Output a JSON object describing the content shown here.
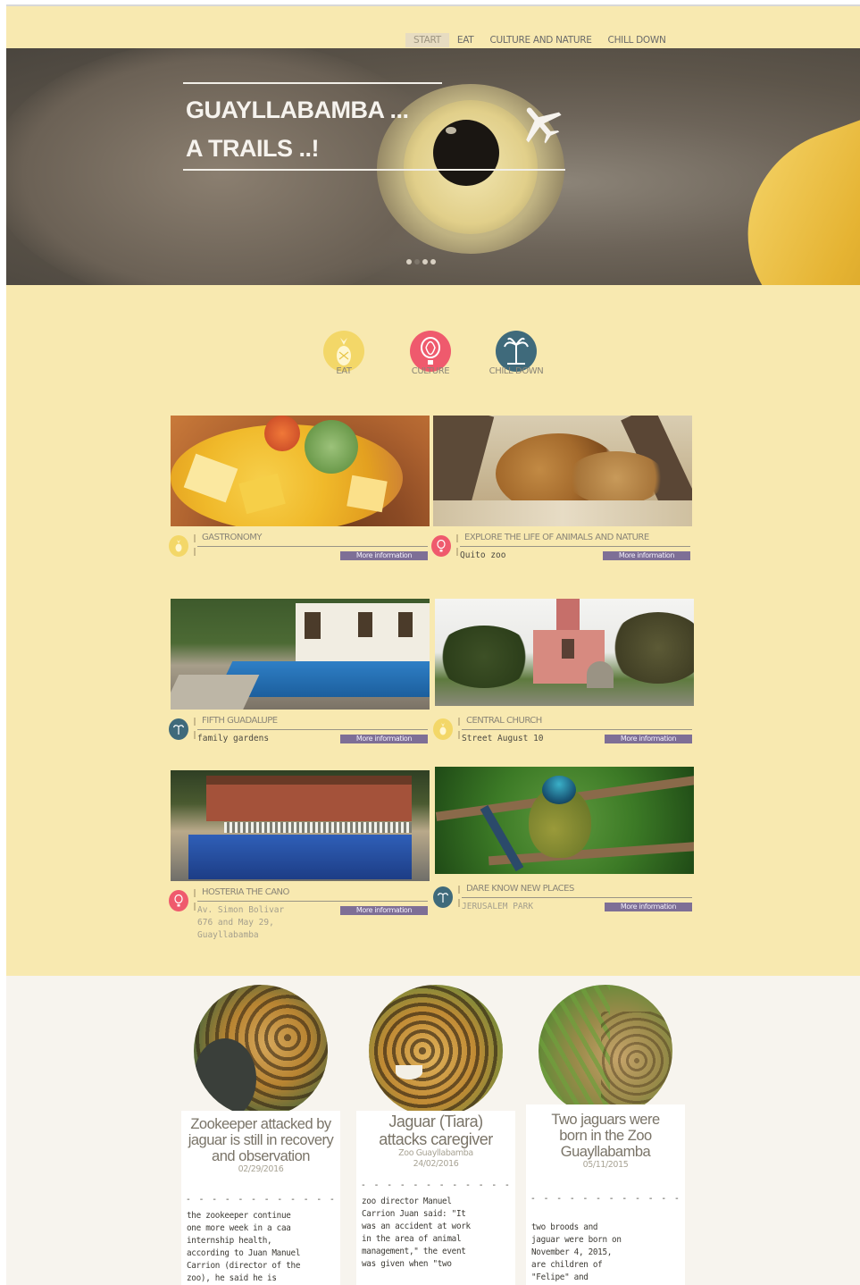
{
  "nav": {
    "items": [
      "START",
      "EAT",
      "CULTURE AND NATURE",
      "CHILL DOWN"
    ]
  },
  "hero": {
    "title_line1": "GUAYLLABAMBA ...",
    "title_line2": "A TRAILS ..!",
    "slides": {
      "count": 4,
      "active": 2
    }
  },
  "categories": [
    {
      "label": "EAT",
      "color": "#f3d768",
      "icon": "pineapple-icon"
    },
    {
      "label": "CULTURE",
      "color": "#ef5a6d",
      "icon": "hot-air-balloon-icon"
    },
    {
      "label": "CHILL DOWN",
      "color": "#3f6a7b",
      "icon": "palm-tree-icon"
    }
  ],
  "cards": [
    {
      "title": "GASTRONOMY",
      "subtitle": "",
      "more": "More information",
      "pin_color": "#f3d768",
      "pin_icon": "pineapple-icon",
      "image": "soup-photo"
    },
    {
      "title": "EXPLORE THE LIFE OF ANIMALS AND NATURE",
      "subtitle": "Quito zoo",
      "more": "More information",
      "pin_color": "#ef5a6d",
      "pin_icon": "hot-air-balloon-icon",
      "image": "lion-photo"
    },
    {
      "title": "FIFTH GUADALUPE",
      "subtitle": "family gardens",
      "more": "More information",
      "pin_color": "#3f6a7b",
      "pin_icon": "palm-tree-icon",
      "image": "pool-garden-photo"
    },
    {
      "title": "CENTRAL CHURCH",
      "subtitle": "Street August 10",
      "more": "More information",
      "pin_color": "#f3d768",
      "pin_icon": "pineapple-icon",
      "image": "church-photo"
    },
    {
      "title": "HOSTERIA THE CANO",
      "subtitle_lines": [
        "Av. Simon Bolivar",
        "676 and May 29,",
        "Guayllabamba"
      ],
      "more": "More information",
      "pin_color": "#ef5a6d",
      "pin_icon": "hot-air-balloon-icon",
      "image": "hostel-pool-photo"
    },
    {
      "title": "DARE KNOW NEW PLACES",
      "subtitle": "JERUSALEM PARK",
      "more": "More information",
      "pin_color": "#3f6a7b",
      "pin_icon": "palm-tree-icon",
      "image": "bird-photo"
    }
  ],
  "news": [
    {
      "headline": "Zookeeper attacked by jaguar is still in recovery and observation",
      "source": "",
      "date": "02/29/2016",
      "dash": "- - - - - - - - - - - -",
      "body": [
        "the zookeeper continue",
        "one more week in a caa",
        "internship health,",
        "according to Juan Manuel",
        "Carrion (director of the",
        "zoo), he said he is"
      ]
    },
    {
      "headline": "Jaguar (Tiara) attacks caregiver",
      "source": "Zoo Guayllabamba",
      "date": "24/02/2016",
      "dash": "- - - - - - - - - - - -",
      "body": [
        "zoo director Manuel",
        "Carrion Juan said: \"It",
        "was an accident at work",
        "in the area of animal",
        "management,\" the event",
        "was given when \"two"
      ]
    },
    {
      "headline": "Two jaguars were born in the Zoo Guayllabamba",
      "source": "",
      "date": "05/11/2015",
      "dash": "- - - - - - - - - - - -",
      "body": [
        "",
        "two broods and",
        "jaguar were born on",
        "November 4, 2015,",
        "are children of",
        "\"Felipe\" and"
      ]
    }
  ]
}
